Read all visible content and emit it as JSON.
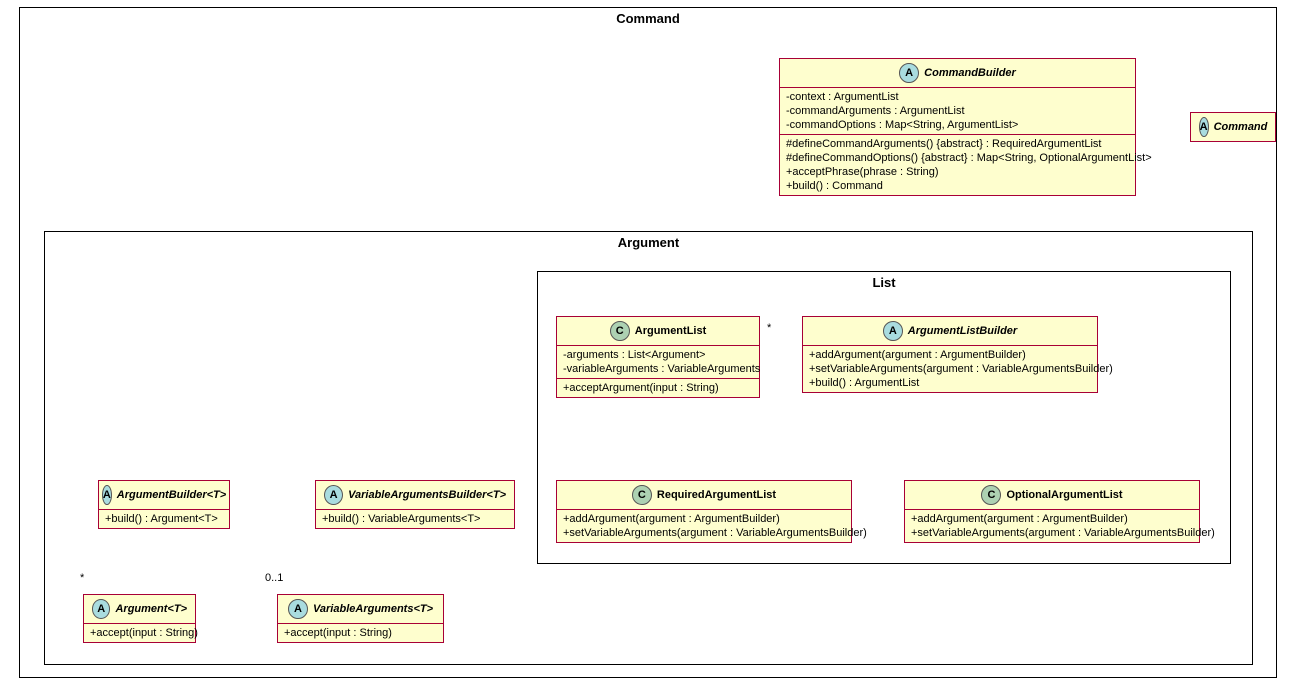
{
  "packages": {
    "command": {
      "title": "Command"
    },
    "argument": {
      "title": "Argument"
    },
    "list": {
      "title": "List"
    }
  },
  "classes": {
    "CommandBuilder": {
      "name": "CommandBuilder",
      "badge": "A",
      "attrs": [
        "-context : ArgumentList",
        "-commandArguments : ArgumentList",
        "-commandOptions : Map<String, ArgumentList>"
      ],
      "ops": [
        "#defineCommandArguments() {abstract} : RequiredArgumentList",
        "#defineCommandOptions() {abstract} : Map<String, OptionalArgumentList>",
        "+acceptPhrase(phrase : String)",
        "+build() : Command"
      ]
    },
    "Command": {
      "name": "Command",
      "badge": "A"
    },
    "ArgumentList": {
      "name": "ArgumentList",
      "badge": "C",
      "attrs": [
        "-arguments : List<Argument>",
        "-variableArguments : VariableArguments"
      ],
      "ops": [
        "+acceptArgument(input : String)"
      ]
    },
    "ArgumentListBuilder": {
      "name": "ArgumentListBuilder",
      "badge": "A",
      "ops": [
        "+addArgument(argument : ArgumentBuilder)",
        "+setVariableArguments(argument : VariableArgumentsBuilder)",
        "+build() : ArgumentList"
      ]
    },
    "RequiredArgumentList": {
      "name": "RequiredArgumentList",
      "badge": "C",
      "ops": [
        "+addArgument(argument : ArgumentBuilder)",
        "+setVariableArguments(argument : VariableArgumentsBuilder)"
      ]
    },
    "OptionalArgumentList": {
      "name": "OptionalArgumentList",
      "badge": "C",
      "ops": [
        "+addArgument(argument : ArgumentBuilder)",
        "+setVariableArguments(argument : VariableArgumentsBuilder)"
      ]
    },
    "ArgumentBuilder": {
      "name": "ArgumentBuilder<T>",
      "badge": "A",
      "ops": [
        "+build() : Argument<T>"
      ]
    },
    "VariableArgumentsBuilder": {
      "name": "VariableArgumentsBuilder<T>",
      "badge": "A",
      "ops": [
        "+build() : VariableArguments<T>"
      ]
    },
    "Argument": {
      "name": "Argument<T>",
      "badge": "A",
      "ops": [
        "+accept(input : String)"
      ]
    },
    "VariableArguments": {
      "name": "VariableArguments<T>",
      "badge": "A",
      "ops": [
        "+accept(input : String)"
      ]
    }
  },
  "labels": {
    "argListMultiplicity": "*",
    "argMultiplicity": "*",
    "varArgMultiplicity": "0..1"
  }
}
